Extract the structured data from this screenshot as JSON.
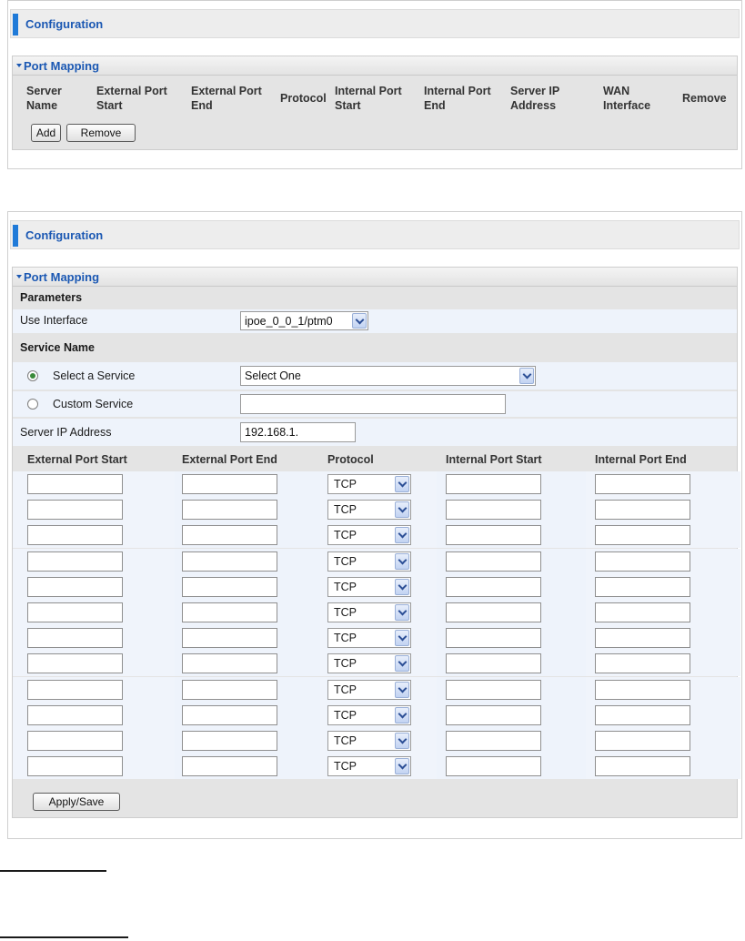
{
  "panel1": {
    "config_title": "Configuration",
    "section_title": "Port Mapping",
    "columns": [
      "Server\nName",
      "External Port\nStart",
      "External Port\nEnd",
      "Protocol",
      "Internal Port\nStart",
      "Internal Port\nEnd",
      "Server IP\nAddress",
      "WAN\nInterface",
      "Remove"
    ],
    "add_label": "Add",
    "remove_label": "Remove"
  },
  "panel2": {
    "config_title": "Configuration",
    "section_title": "Port Mapping",
    "parameters_label": "Parameters",
    "use_interface_label": "Use Interface",
    "use_interface_value": "ipoe_0_0_1/ptm0",
    "service_name_label": "Service Name",
    "select_service_label": "Select a Service",
    "select_service_value": "Select One",
    "custom_service_label": "Custom Service",
    "server_ip_label": "Server IP Address",
    "server_ip_value": "192.168.1.",
    "grid_headers": {
      "ext_start": "External Port Start",
      "ext_end": "External Port End",
      "protocol": "Protocol",
      "int_start": "Internal Port Start",
      "int_end": "Internal Port End"
    },
    "protocol_value": "TCP",
    "apply_label": "Apply/Save"
  },
  "colors": {
    "accent": "#1f7ad8",
    "title_blue": "#1b58b3",
    "row_light": "#eef3fb",
    "row_gray": "#e4e4e4"
  }
}
